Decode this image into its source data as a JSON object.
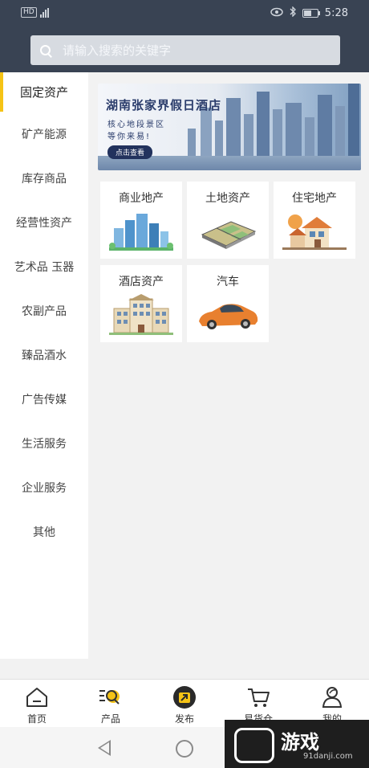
{
  "status": {
    "hd": "HD",
    "time": "5:28"
  },
  "search": {
    "placeholder": "请输入搜索的关键字"
  },
  "sidebar": {
    "items": [
      {
        "label": "固定资产",
        "active": true
      },
      {
        "label": "矿产能源"
      },
      {
        "label": "库存商品"
      },
      {
        "label": "经营性资产"
      },
      {
        "label": "艺术品 玉器"
      },
      {
        "label": "农副产品"
      },
      {
        "label": "臻品酒水"
      },
      {
        "label": "广告传媒"
      },
      {
        "label": "生活服务"
      },
      {
        "label": "企业服务"
      },
      {
        "label": "其他"
      }
    ]
  },
  "banner": {
    "title": "湖南张家界假日酒店",
    "subtitle_line1": "核心地段景区",
    "subtitle_line2": "等你来易!",
    "button": "点击查看"
  },
  "categories": [
    {
      "label": "商业地产",
      "icon": "commercial-building-icon"
    },
    {
      "label": "土地资产",
      "icon": "land-plot-icon"
    },
    {
      "label": "住宅地产",
      "icon": "residential-house-icon"
    },
    {
      "label": "酒店资产",
      "icon": "hotel-building-icon"
    },
    {
      "label": "汽车",
      "icon": "car-icon"
    }
  ],
  "bottom_nav": [
    {
      "label": "首页",
      "icon": "home-icon"
    },
    {
      "label": "产品",
      "icon": "product-search-icon"
    },
    {
      "label": "发布",
      "icon": "publish-icon"
    },
    {
      "label": "易货仓",
      "icon": "cart-icon"
    },
    {
      "label": "我的",
      "icon": "profile-icon"
    }
  ],
  "watermark": {
    "text": "游戏",
    "url": "91danji.com"
  },
  "colors": {
    "header": "#394353",
    "accent": "#f5c315",
    "banner_button": "#22325d"
  }
}
